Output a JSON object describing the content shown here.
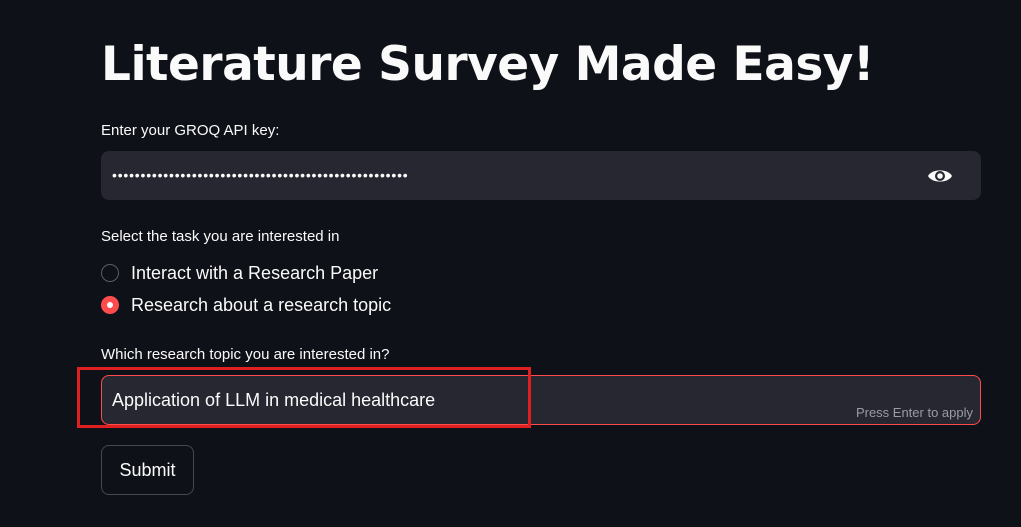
{
  "page": {
    "title": "Literature Survey Made Easy!"
  },
  "api_key": {
    "label": "Enter your GROQ API key:",
    "masked_value": "••••••••••••••••••••••••••••••••••••••••••••••••••••",
    "toggle_icon": "eye-icon"
  },
  "task": {
    "label": "Select the task you are interested in",
    "options": [
      {
        "label": "Interact with a Research Paper",
        "selected": false
      },
      {
        "label": "Research about a research topic",
        "selected": true
      }
    ]
  },
  "topic": {
    "label": "Which research topic you are interested in?",
    "value": "Application of LLM in medical healthcare",
    "hint": "Press Enter to apply"
  },
  "submit": {
    "label": "Submit"
  },
  "colors": {
    "background": "#0e1117",
    "input_background": "#262730",
    "accent": "#ff4b4b",
    "annotation_box": "#e02020"
  }
}
